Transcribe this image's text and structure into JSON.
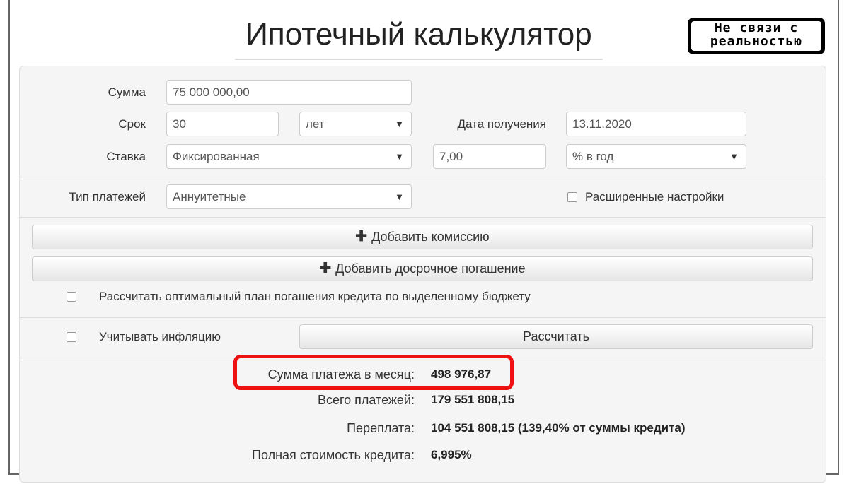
{
  "page": {
    "title": "Ипотечный калькулятор",
    "stamp_line1": "Не связи с",
    "stamp_line2": "реальностью"
  },
  "form": {
    "amount_label": "Сумма",
    "amount_value": "75 000 000,00",
    "term_label": "Срок",
    "term_value": "30",
    "term_unit": "лет",
    "date_label": "Дата получения",
    "date_value": "13.11.2020",
    "rate_label": "Ставка",
    "rate_type": "Фиксированная",
    "rate_value": "7,00",
    "rate_unit": "% в год",
    "payment_type_label": "Тип платежей",
    "payment_type_value": "Аннуитетные",
    "advanced_label": "Расширенные настройки",
    "caret": "▼"
  },
  "buttons": {
    "plus": "✚",
    "add_commission": "Добавить комиссию",
    "add_early": "Добавить досрочное погашение",
    "calculate": "Рассчитать"
  },
  "options": {
    "optimal_plan": "Рассчитать оптимальный план погашения кредита по выделенному бюджету",
    "inflation": "Учитывать инфляцию"
  },
  "results": {
    "monthly_label": "Сумма платежа в месяц:",
    "monthly_value": "498 976,87",
    "total_label": "Всего платежей:",
    "total_value": "179 551 808,15",
    "overpay_label": "Переплата:",
    "overpay_value": "104 551 808,15 (139,40% от суммы кредита)",
    "full_cost_label": "Полная стоимость кредита:",
    "full_cost_value": "6,995%"
  },
  "colors": {
    "highlight": "#ee1111"
  }
}
